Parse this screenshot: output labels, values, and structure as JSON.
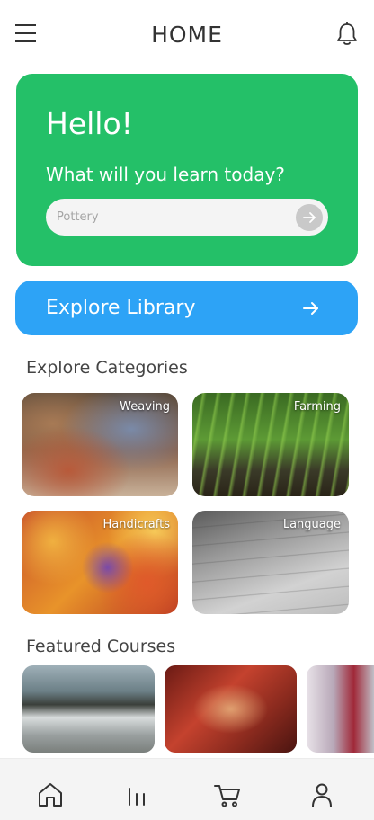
{
  "header": {
    "title": "HOME"
  },
  "hero": {
    "greeting": "Hello!",
    "prompt": "What will you learn today?",
    "search_placeholder": "Pottery",
    "background_color": "#24c068"
  },
  "explore": {
    "label": "Explore Library",
    "background_color": "#2da3f6"
  },
  "categories": {
    "title": "Explore Categories",
    "items": [
      {
        "label": "Weaving"
      },
      {
        "label": "Farming"
      },
      {
        "label": "Handicrafts"
      },
      {
        "label": "Language"
      }
    ]
  },
  "featured": {
    "title": "Featured Courses"
  },
  "bottom_nav": {
    "items": [
      {
        "icon": "home-icon"
      },
      {
        "icon": "stats-icon"
      },
      {
        "icon": "cart-icon"
      },
      {
        "icon": "profile-icon"
      }
    ]
  }
}
